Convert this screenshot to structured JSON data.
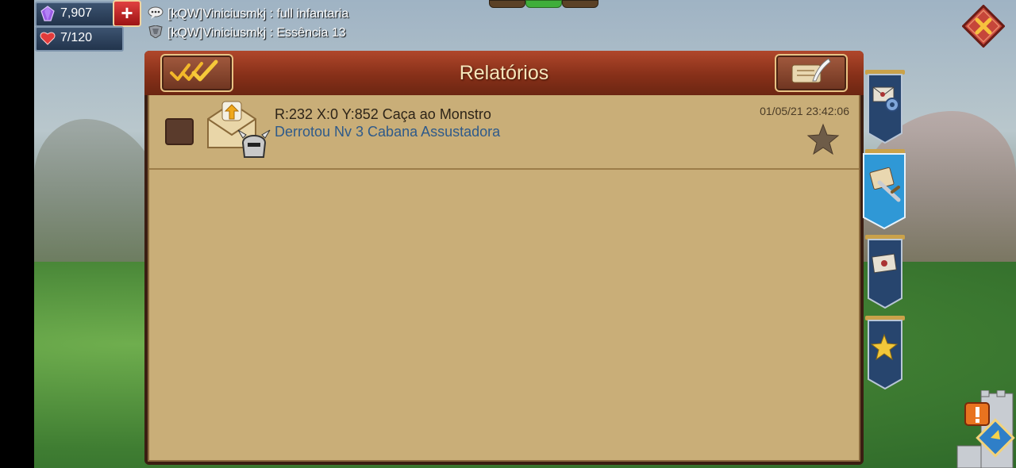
{
  "resources": {
    "gems": "7,907",
    "gem_icon": "purple-gem-icon",
    "plus_label": "+",
    "stamina": "7/120",
    "stamina_icon": "heart-icon"
  },
  "chat": [
    {
      "icon": "speech-bubble-icon",
      "text": "[kQW]Viniciusmkj : full infantaria"
    },
    {
      "icon": "guild-emblem-icon",
      "text": "[kQW]Viniciusmkj : Essência 13"
    }
  ],
  "panel": {
    "title": "Relatórios",
    "mark_all_icon": "double-checkmark-icon",
    "compose_icon": "scroll-quill-icon"
  },
  "reports": [
    {
      "title": "R:232 X:0 Y:852 Caça ao Monstro",
      "subtitle": "Derrotou Nv 3 Cabana Assustadora",
      "timestamp": "01/05/21 23:42:06",
      "favorited": false
    }
  ],
  "side_tabs": [
    {
      "icon": "mail-settings-icon",
      "active": false
    },
    {
      "icon": "battle-report-icon",
      "active": true
    },
    {
      "icon": "sealed-letter-icon",
      "active": false
    },
    {
      "icon": "star-icon",
      "active": false
    }
  ],
  "colors": {
    "header": "#873019",
    "content_bg": "#c9ae78",
    "subtitle": "#2e5a8a",
    "active_tab": "#2f98d6",
    "inactive_tab": "#27456e"
  }
}
